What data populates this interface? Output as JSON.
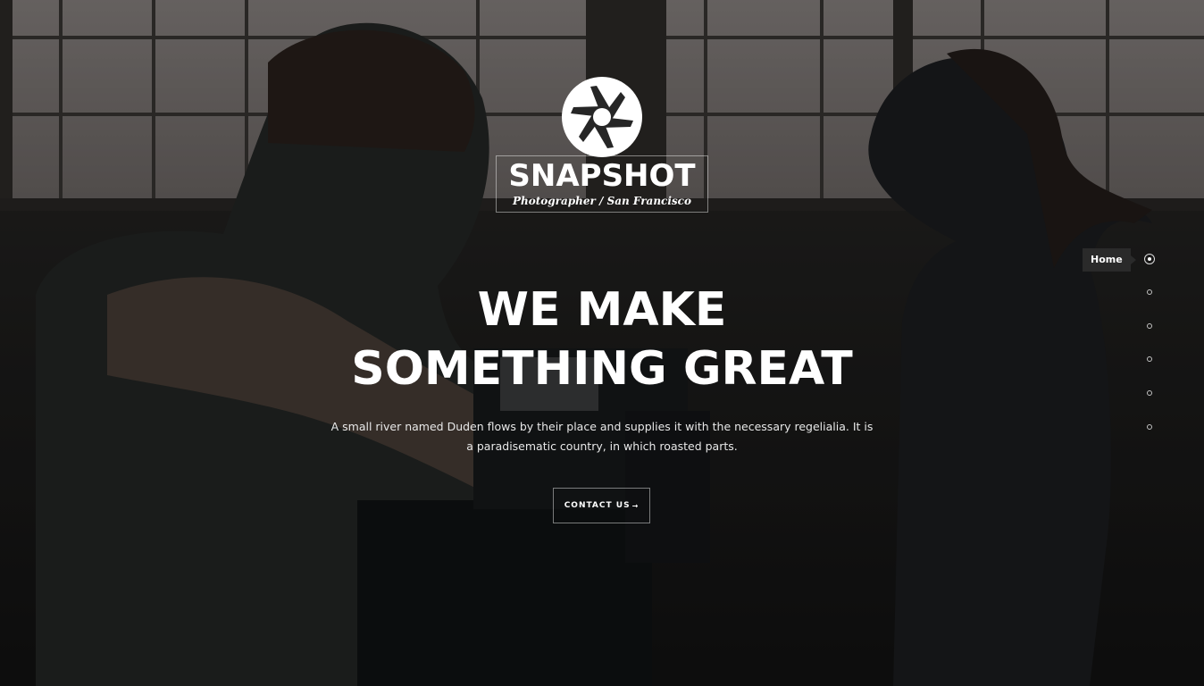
{
  "brand": {
    "name": "SNAPSHOT",
    "tagline": "Photographer / San Francisco",
    "logo_icon": "camera-aperture-icon"
  },
  "hero": {
    "headline_line1": "WE MAKE",
    "headline_line2": "SOMETHING GREAT",
    "lead": "A small river named Duden flows by their place and supplies it with the necessary regelialia. It is a paradisematic country, in which roasted parts.",
    "cta_label": "CONTACT US",
    "cta_arrow": "→"
  },
  "section_nav": {
    "tooltip": "Home",
    "dots": [
      {
        "active": true
      },
      {
        "active": false
      },
      {
        "active": false
      },
      {
        "active": false
      },
      {
        "active": false
      },
      {
        "active": false
      }
    ]
  },
  "colors": {
    "text": "#ffffff",
    "tooltip_bg": "#2a2a2a"
  }
}
